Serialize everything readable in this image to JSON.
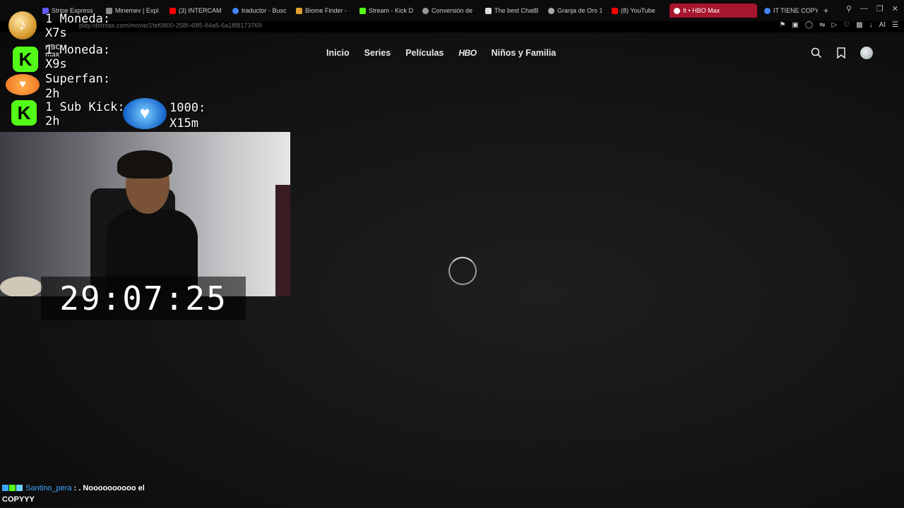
{
  "browser": {
    "tabs": [
      {
        "title": "Stripe Express",
        "color": "#635bff"
      },
      {
        "title": "Minemev | Expl",
        "color": "#888888"
      },
      {
        "title": "(3) INTERCAM",
        "color": "#ff0000"
      },
      {
        "title": "traductor - Busc",
        "color": "#4285f4"
      },
      {
        "title": "Biome Finder - ",
        "color": "#e0a030"
      },
      {
        "title": "Stream - Kick D",
        "color": "#53fc18"
      },
      {
        "title": "Conversión de ",
        "color": "#999999"
      },
      {
        "title": "The best ChatB",
        "color": "#dddddd"
      },
      {
        "title": "Granja de Oro 1",
        "color": "#aaaaaa"
      },
      {
        "title": "(8) YouTube",
        "color": "#ff0000"
      },
      {
        "title": "It • HBO Max",
        "color": "#ffffff",
        "active": true
      },
      {
        "title": "IT TIENE COPY",
        "color": "#4285f4"
      }
    ],
    "url": "play.hbomax.com/movie/1fef0800-258f-49f5-84a5-6a1f88173769"
  },
  "nav": {
    "items": [
      "Inicio",
      "Series",
      "Películas",
      "HBO",
      "Niños y Familia"
    ]
  },
  "overlay": {
    "alerts": [
      {
        "label": "1 Moneda:",
        "value": "X7s"
      },
      {
        "label": "1 Moneda:",
        "value": "X9s"
      },
      {
        "label": "Superfan:",
        "value": "2h"
      },
      {
        "label": "1 Sub Kick:",
        "value": "2h"
      },
      {
        "label": "1000:",
        "value": "X15m"
      }
    ],
    "hbomax_mini": "HBO\nmax",
    "timer": "29:07:25",
    "chat": {
      "user": "Santino_pera",
      "separator": " : ",
      "message": ". Noooooooooo el",
      "message_cont": "COPYYY"
    }
  }
}
